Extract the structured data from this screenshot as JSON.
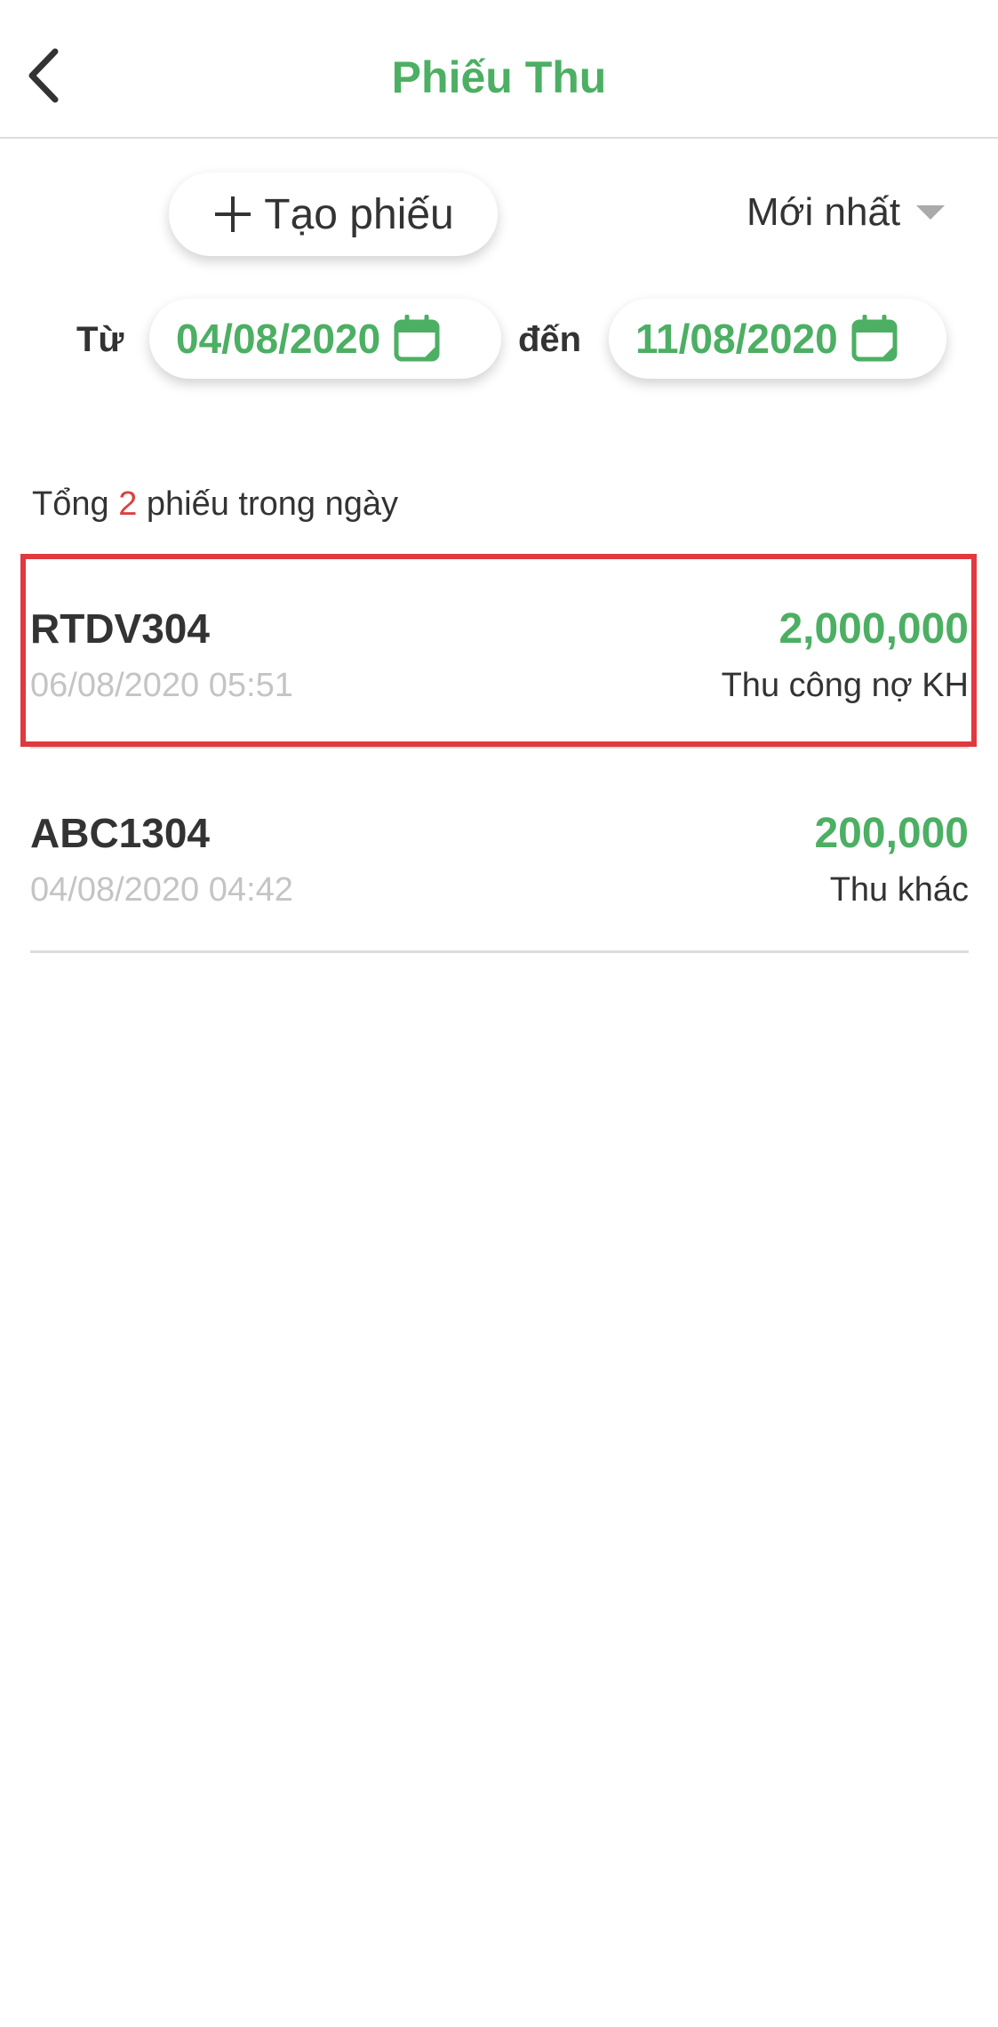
{
  "header": {
    "title": "Phiếu Thu",
    "back_icon": "chevron-left-icon"
  },
  "toolbar": {
    "create_icon": "plus-icon",
    "create_label": "Tạo phiếu",
    "sort_label": "Mới nhất",
    "sort_icon": "caret-down-icon"
  },
  "date_filter": {
    "from_label": "Từ",
    "from_value": "04/08/2020",
    "to_label": "đến",
    "to_value": "11/08/2020",
    "calendar_icon": "calendar-icon"
  },
  "summary": {
    "prefix": "Tổng",
    "count": "2",
    "suffix": "phiếu trong ngày"
  },
  "receipts": [
    {
      "code": "RTDV304",
      "datetime": "06/08/2020 05:51",
      "amount": "2,000,000",
      "type": "Thu công nợ KH"
    },
    {
      "code": "ABC1304",
      "datetime": "04/08/2020 04:42",
      "amount": "200,000",
      "type": "Thu khác"
    }
  ],
  "colors": {
    "accent_green": "#4caf63",
    "count_red": "#d9433f",
    "highlight_red": "#e0393f",
    "muted_gray": "#c4c4c4"
  }
}
